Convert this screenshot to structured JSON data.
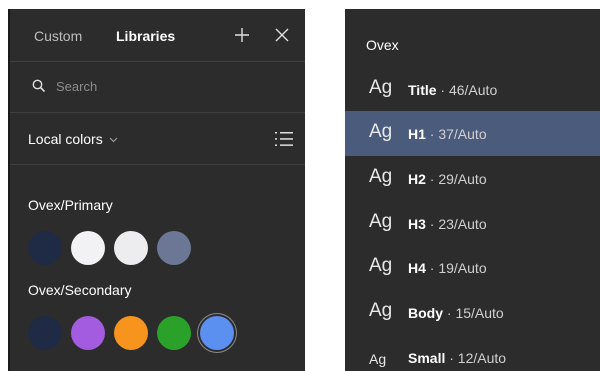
{
  "left_panel": {
    "tabs": [
      {
        "label": "Custom",
        "active": false
      },
      {
        "label": "Libraries",
        "active": true
      }
    ],
    "search": {
      "placeholder": "Search",
      "value": ""
    },
    "local_colors_label": "Local colors",
    "groups": [
      {
        "title": "Ovex/Primary",
        "swatches": [
          "#1f2a44",
          "#f2f2f4",
          "#ededef",
          "#6b7794"
        ]
      },
      {
        "title": "Ovex/Secondary",
        "swatches": [
          "#1f2a44",
          "#a35be0",
          "#f7941e",
          "#2aa22a",
          "#5b8ff0"
        ],
        "selected_index": 4
      }
    ]
  },
  "right_panel": {
    "title": "Ovex",
    "ag_glyph": "Ag",
    "styles": [
      {
        "name": "Title",
        "spec": " · 46/Auto",
        "selected": false
      },
      {
        "name": "H1",
        "spec": " · 37/Auto",
        "selected": true
      },
      {
        "name": "H2",
        "spec": " · 29/Auto",
        "selected": false
      },
      {
        "name": "H3",
        "spec": " · 23/Auto",
        "selected": false
      },
      {
        "name": "H4",
        "spec": " · 19/Auto",
        "selected": false
      },
      {
        "name": "Body",
        "spec": " · 15/Auto",
        "selected": false
      },
      {
        "name": "Small",
        "spec": " · 12/Auto",
        "selected": false
      }
    ]
  },
  "colors": {
    "panel_bg": "#2c2c2c",
    "selected_row": "#4b5b7b",
    "divider": "#3f3f3f"
  }
}
